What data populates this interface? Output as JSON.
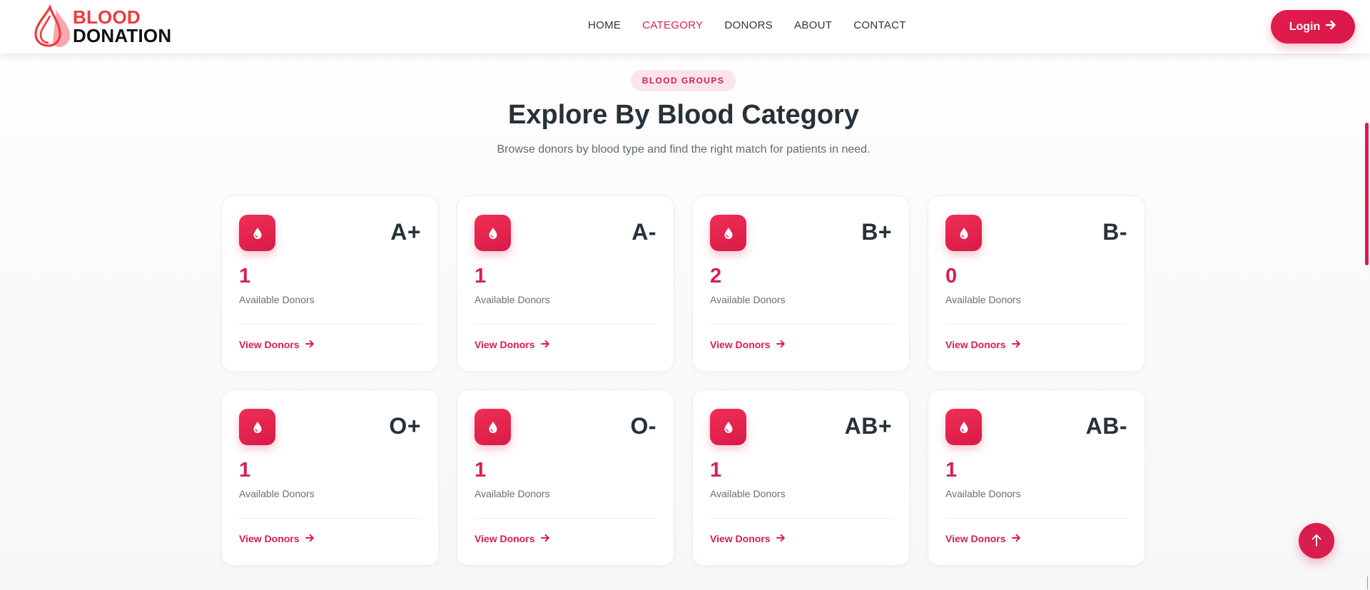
{
  "header": {
    "logo": {
      "line1": "BLOOD",
      "line2": "DONATION"
    },
    "nav": [
      {
        "label": "HOME",
        "active": false
      },
      {
        "label": "CATEGORY",
        "active": true
      },
      {
        "label": "DONORS",
        "active": false
      },
      {
        "label": "ABOUT",
        "active": false
      },
      {
        "label": "CONTACT",
        "active": false
      }
    ],
    "login_label": "Login"
  },
  "section": {
    "badge": "BLOOD GROUPS",
    "title": "Explore By Blood Category",
    "subtitle": "Browse donors by blood type and find the right match for patients in need."
  },
  "cards": [
    {
      "type": "A+",
      "count": "1",
      "label": "Available Donors",
      "link": "View Donors"
    },
    {
      "type": "A-",
      "count": "1",
      "label": "Available Donors",
      "link": "View Donors"
    },
    {
      "type": "B+",
      "count": "2",
      "label": "Available Donors",
      "link": "View Donors"
    },
    {
      "type": "B-",
      "count": "0",
      "label": "Available Donors",
      "link": "View Donors"
    },
    {
      "type": "O+",
      "count": "1",
      "label": "Available Donors",
      "link": "View Donors"
    },
    {
      "type": "O-",
      "count": "1",
      "label": "Available Donors",
      "link": "View Donors"
    },
    {
      "type": "AB+",
      "count": "1",
      "label": "Available Donors",
      "link": "View Donors"
    },
    {
      "type": "AB-",
      "count": "1",
      "label": "Available Donors",
      "link": "View Donors"
    }
  ],
  "icons": {
    "logo": "blood-drop-logo-icon",
    "card": "blood-drop-icon",
    "link": "arrow-right-icon",
    "login": "arrow-right-icon",
    "scroll_top": "arrow-up-icon"
  },
  "colors": {
    "accent": "#d71f4d",
    "logo_red": "#ef3a3f",
    "heading": "#263238",
    "badge_bg": "#fce4ea"
  }
}
